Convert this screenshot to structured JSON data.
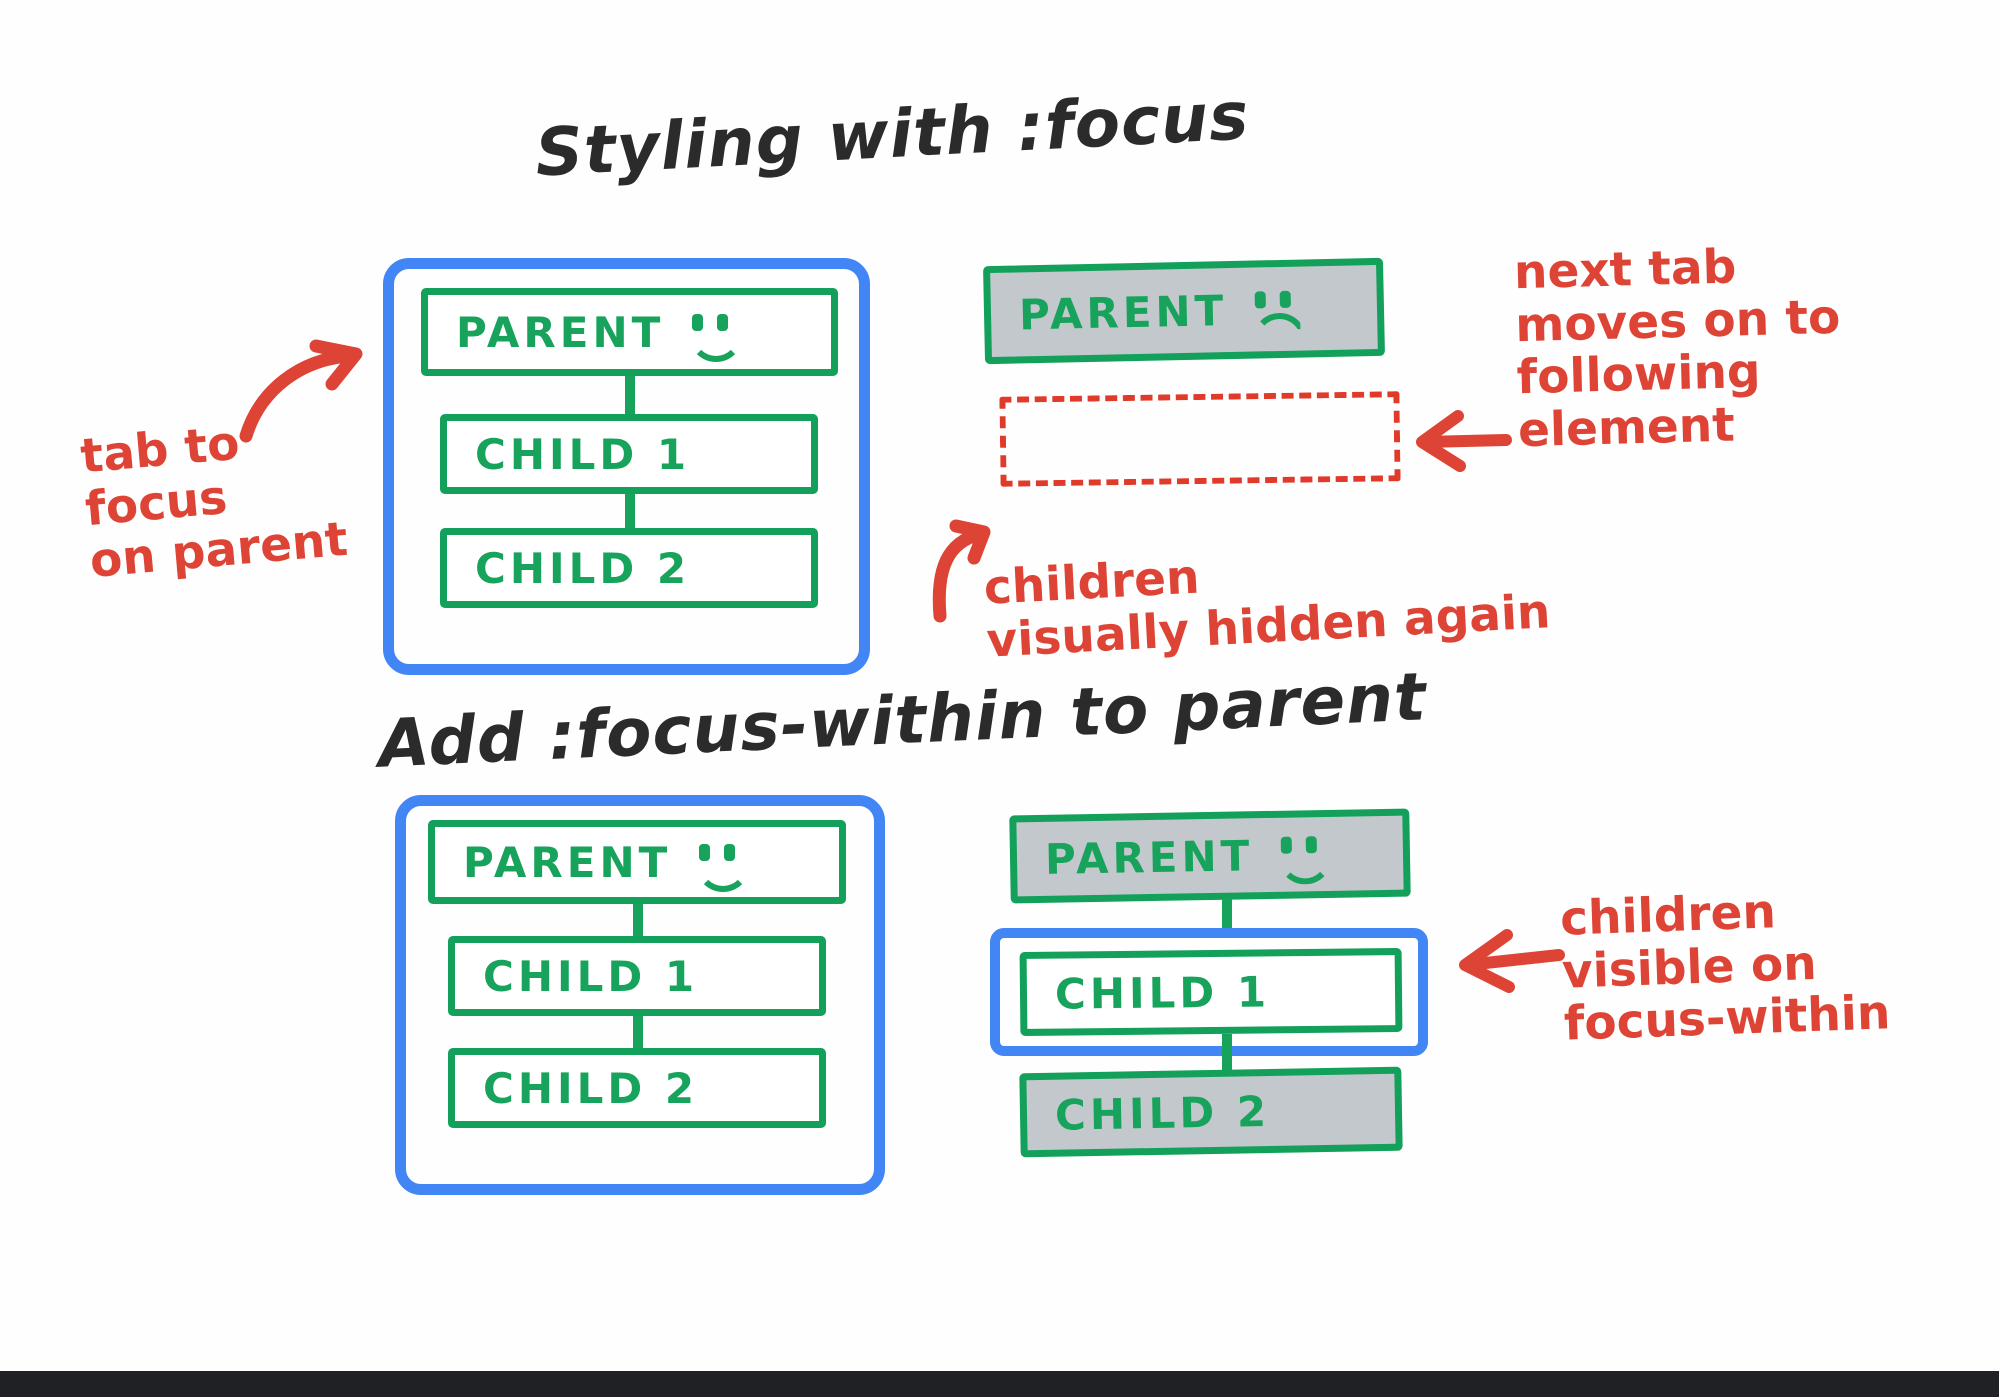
{
  "headings": {
    "top": "Styling with :focus",
    "middle": "Add  :focus-within  to parent"
  },
  "diagrams": {
    "top_left": {
      "name": "focus-on-parent-default",
      "focus_ring": "parent-wrapper",
      "nodes": [
        {
          "label": "PARENT",
          "face": "smile",
          "shaded": false
        },
        {
          "label": "CHILD 1",
          "face": "none",
          "shaded": false
        },
        {
          "label": "CHILD 2",
          "face": "none",
          "shaded": false
        }
      ]
    },
    "top_right": {
      "name": "focus-moved-away",
      "focus_ring": "none",
      "nodes": [
        {
          "label": "PARENT",
          "face": "frown",
          "shaded": true
        }
      ],
      "empty_slot_label": ""
    },
    "bottom_left": {
      "name": "focus-within-default",
      "focus_ring": "parent-wrapper",
      "nodes": [
        {
          "label": "PARENT",
          "face": "smile",
          "shaded": false
        },
        {
          "label": "CHILD 1",
          "face": "none",
          "shaded": false
        },
        {
          "label": "CHILD 2",
          "face": "none",
          "shaded": false
        }
      ]
    },
    "bottom_right": {
      "name": "focus-within-active",
      "focus_ring": "child-1",
      "nodes": [
        {
          "label": "PARENT",
          "face": "smile",
          "shaded": true
        },
        {
          "label": "CHILD 1",
          "face": "none",
          "shaded": false
        },
        {
          "label": "CHILD 2",
          "face": "none",
          "shaded": true
        }
      ]
    }
  },
  "annotations": {
    "tab_to_focus": "tab to\nfocus\non parent",
    "next_tab": "next tab\nmoves on to\nfollowing\nelement",
    "children_hidden": "children\nvisually hidden again",
    "children_visible": "children\nvisible on\nfocus-within"
  },
  "colors": {
    "green": "#17a35c",
    "blue": "#4285f4",
    "red": "#dd4436",
    "shade": "#c3c8cd",
    "ink": "#2b2b2b"
  }
}
